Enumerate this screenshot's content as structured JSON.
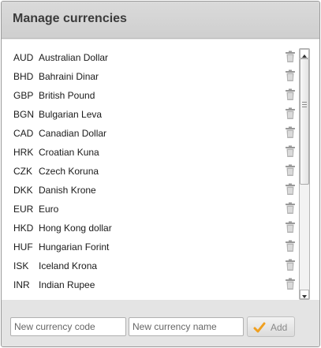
{
  "dialog": {
    "title": "Manage currencies",
    "delete_icon": "trash-icon",
    "currencies": [
      {
        "code": "AUD",
        "name": "Australian Dollar"
      },
      {
        "code": "BHD",
        "name": "Bahraini Dinar"
      },
      {
        "code": "GBP",
        "name": "British Pound"
      },
      {
        "code": "BGN",
        "name": "Bulgarian Leva"
      },
      {
        "code": "CAD",
        "name": "Canadian Dollar"
      },
      {
        "code": "HRK",
        "name": "Croatian Kuna"
      },
      {
        "code": "CZK",
        "name": "Czech Koruna"
      },
      {
        "code": "DKK",
        "name": "Danish Krone"
      },
      {
        "code": "EUR",
        "name": "Euro"
      },
      {
        "code": "HKD",
        "name": "Hong Kong dollar"
      },
      {
        "code": "HUF",
        "name": "Hungarian Forint"
      },
      {
        "code": "ISK",
        "name": "Iceland Krona"
      },
      {
        "code": "INR",
        "name": "Indian Rupee"
      }
    ]
  },
  "footer": {
    "code_placeholder": "New currency code",
    "name_placeholder": "New currency name",
    "add_label": "Add",
    "add_icon": "checkmark-icon",
    "check_color": "#f0a020"
  }
}
